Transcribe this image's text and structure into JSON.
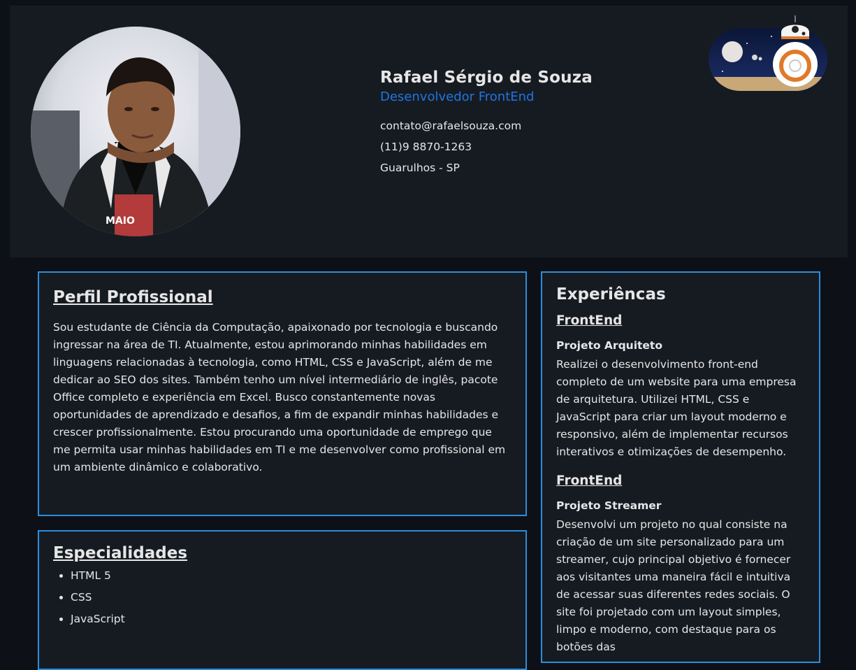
{
  "profile": {
    "name": "Rafael Sérgio de Souza",
    "role": "Desenvolvedor FrontEnd",
    "email": "contato@rafaelsouza.com",
    "phone": "(11)9 8870-1263",
    "location": "Guarulhos - SP",
    "photo_alt": "Foto de Rafael Sérgio de Souza"
  },
  "perfil": {
    "title": "Perfil Profissional",
    "text": "Sou estudante de Ciência da Computação, apaixonado por tecnologia e buscando ingressar na área de TI. Atualmente, estou aprimorando minhas habilidades em linguagens relacionadas à tecnologia, como HTML, CSS e JavaScript, além de me dedicar ao SEO dos sites. Também tenho um nível intermediário de inglês, pacote Office completo e experiência em Excel. Busco constantemente novas oportunidades de aprendizado e desafios, a fim de expandir minhas habilidades e crescer profissionalmente. Estou procurando uma oportunidade de emprego que me permita usar minhas habilidades em TI e me desenvolver como profissional em um ambiente dinâmico e colaborativo."
  },
  "especialidades": {
    "title": "Especialidades",
    "items": [
      "HTML 5",
      "CSS",
      "JavaScript"
    ]
  },
  "experiencias": {
    "title": "Experiêncas",
    "jobs": [
      {
        "type": "FrontEnd",
        "name": "Projeto Arquiteto",
        "desc": "Realizei o desenvolvimento front-end completo de um website para uma empresa de arquitetura. Utilizei HTML, CSS e JavaScript para criar um layout moderno e responsivo, além de implementar recursos interativos e otimizações de desempenho."
      },
      {
        "type": "FrontEnd",
        "name": "Projeto Streamer",
        "desc": "Desenvolvi um projeto no qual consiste na criação de um site personalizado para um streamer, cujo principal objetivo é fornecer aos visitantes uma maneira fácil e intuitiva de acessar suas diferentes redes sociais. O site foi projetado com um layout simples, limpo e moderno, com destaque para os botões das"
      }
    ]
  },
  "theme_toggle": {
    "icon": "bb8-moon-toggle-icon",
    "mode": "dark"
  },
  "colors": {
    "background": "#0d1117",
    "header_bg": "#161b22",
    "accent": "#1f75e0",
    "card_border": "#2d8cdd",
    "text": "#e6e6e6"
  }
}
